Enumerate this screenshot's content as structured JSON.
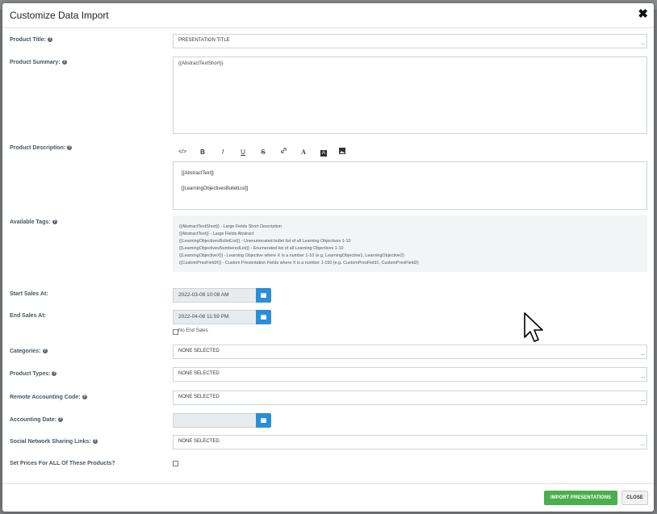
{
  "modal": {
    "title": "Customize Data Import",
    "close_glyph": "✖"
  },
  "fields": {
    "product_title": {
      "label": "Product Title:",
      "value": "PRESENTATION TITLE"
    },
    "product_summary": {
      "label": "Product Summary:",
      "value": "{{AbstractTextShort}}"
    },
    "product_description": {
      "label": "Product Description:",
      "toolbar": [
        "</>",
        "B",
        "I",
        "U",
        "S",
        "link",
        "A",
        "A",
        "img"
      ],
      "lines": [
        "[[AbstractText]]",
        "[[LearningObjectivesBulletList]]"
      ]
    },
    "available_tags": {
      "label": "Available Tags:",
      "lines": [
        "{{AbstractTextShort}} - Large Fields Short Description",
        "{{AbstractText}} - Large Fields Abstract",
        "{{LearningObjectivesBulletList}} - Unenumerated bullet list of all Learning Objectives 1-10",
        "{{LearningObjectivesNumberedList}} - Enumerated list of all Learning Objectives 1-10",
        "{{LearningObjectiveX}} - Learning Objective where X is a number 1-10 (e.g. LearningObjective1, LearningObjective2)",
        "{{CustomPresFieldX}} - Custom Presentation Fields where X is a number 1-150 (e.g. CustomPresField1, CustomPresField2)"
      ]
    },
    "start_sales": {
      "label": "Start Sales At:",
      "value": "2022-03-08 10:08 AM"
    },
    "end_sales": {
      "label": "End Sales At:",
      "value": "2022-04-08 11:59 PM",
      "no_end_label": "No End Sales"
    },
    "categories": {
      "label": "Categories:",
      "value": "NONE SELECTED"
    },
    "product_types": {
      "label": "Product Types:",
      "value": "NONE SELECTED"
    },
    "remote_accounting_code": {
      "label": "Remote Accounting Code:",
      "value": "NONE SELECTED"
    },
    "accounting_date": {
      "label": "Accounting Date:",
      "value": ""
    },
    "social_links": {
      "label": "Social Network Sharing Links:",
      "value": "NONE SELECTED"
    },
    "set_prices": {
      "label": "Set Prices For ALL Of These Products?"
    }
  },
  "footer": {
    "import_label": "IMPORT PRESENTATIONS",
    "close_label": "CLOSE"
  },
  "colors": {
    "accent_blue": "#2a8ed8",
    "import_green": "#4cae4c"
  }
}
